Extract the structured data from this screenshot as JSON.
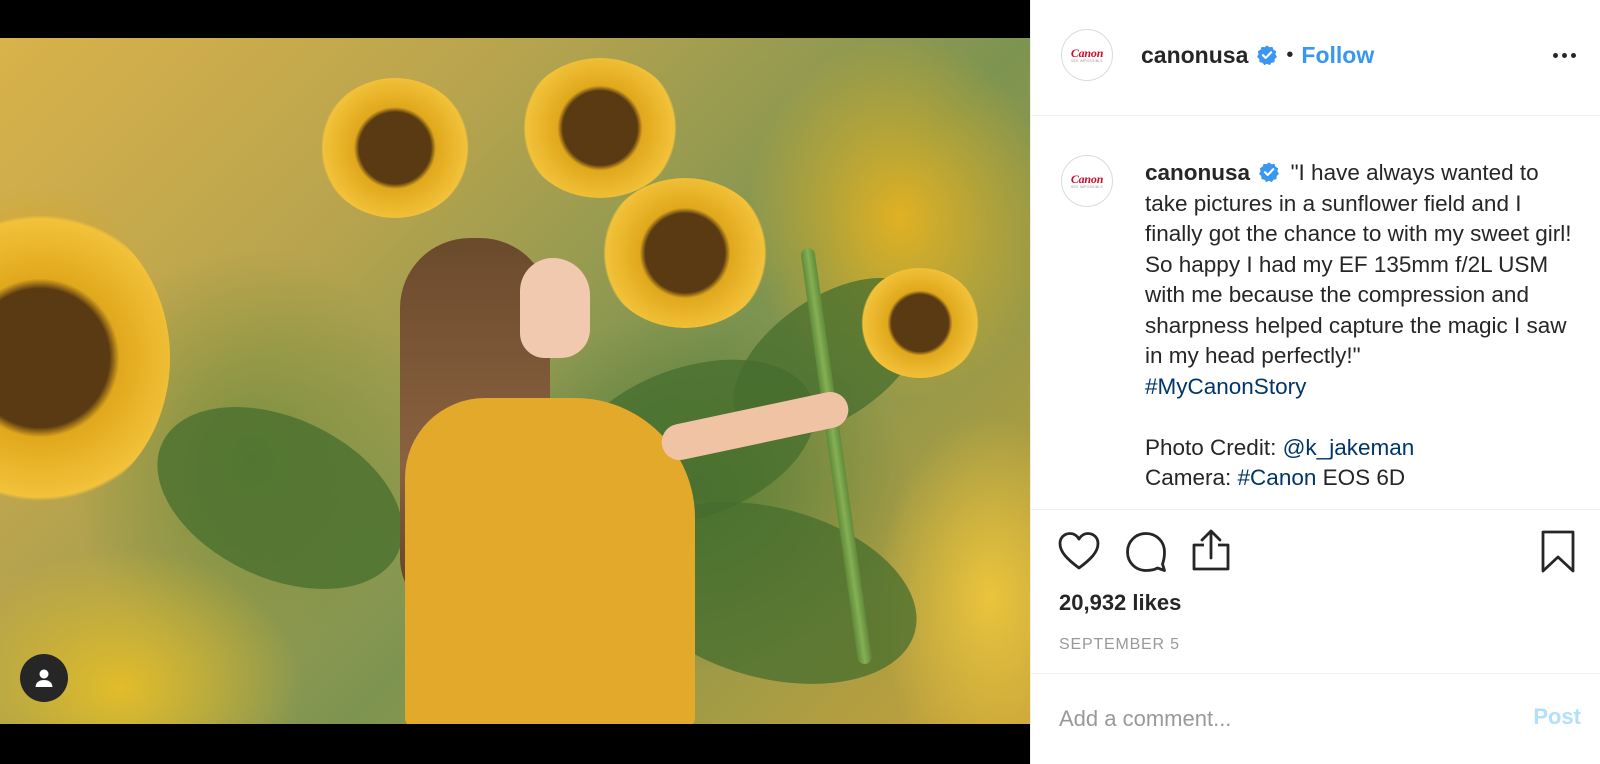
{
  "post": {
    "account": {
      "username": "canonusa",
      "logo_word": "Canon",
      "logo_tagline": "SEE IMPOSSIBLE",
      "verified": true
    },
    "header": {
      "separator": "•",
      "follow_label": "Follow"
    },
    "caption": {
      "username": "canonusa",
      "text": "\"I have always wanted to take pictures in a sunflower field and I finally got the chance to with my sweet girl! So happy I had my EF 135mm f/2L USM with me because the compression and sharpness helped capture the magic I saw in my head perfectly!\"",
      "hashtag": "#MyCanonStory",
      "credit_label": "Photo Credit:",
      "credit_handle": "@k_jakeman",
      "camera_label": "Camera:",
      "camera_hashtag": "#Canon",
      "camera_model": "EOS 6D"
    },
    "stats": {
      "likes": "20,932 likes",
      "date": "SEPTEMBER 5"
    },
    "comment": {
      "placeholder": "Add a comment...",
      "post_label": "Post"
    },
    "icons": {
      "like": "heart-icon",
      "comment": "comment-bubble-icon",
      "share": "share-icon",
      "save": "bookmark-icon",
      "more": "more-options-icon",
      "tagged_user": "user-tag-icon",
      "verified": "verified-badge-icon"
    },
    "colors": {
      "link_blue": "#3897f0",
      "hashtag_navy": "#003569",
      "verified_blue": "#3897f0",
      "canon_red": "#c8102e",
      "muted_gray": "#999999"
    }
  }
}
